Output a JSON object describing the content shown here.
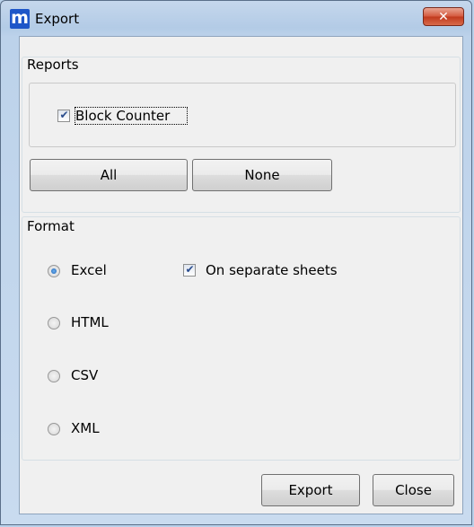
{
  "window": {
    "icon_letter": "m",
    "title": "Export",
    "close_glyph": "✕"
  },
  "reports": {
    "label": "Reports",
    "items": [
      {
        "label": "Block Counter",
        "checked": true
      }
    ],
    "all_label": "All",
    "none_label": "None"
  },
  "format": {
    "label": "Format",
    "options": [
      {
        "label": "Excel",
        "selected": true
      },
      {
        "label": "HTML",
        "selected": false
      },
      {
        "label": "CSV",
        "selected": false
      },
      {
        "label": "XML",
        "selected": false
      }
    ],
    "separate_sheets_label": "On separate sheets",
    "separate_sheets_checked": true
  },
  "footer": {
    "export_label": "Export",
    "close_label": "Close"
  },
  "icons": {
    "check": "check-mark-icon",
    "radio_dot": "radio-dot-icon"
  },
  "colors": {
    "titlebar": "#b9d1ea",
    "close_button": "#c9452a",
    "accent": "#1e56c8"
  }
}
